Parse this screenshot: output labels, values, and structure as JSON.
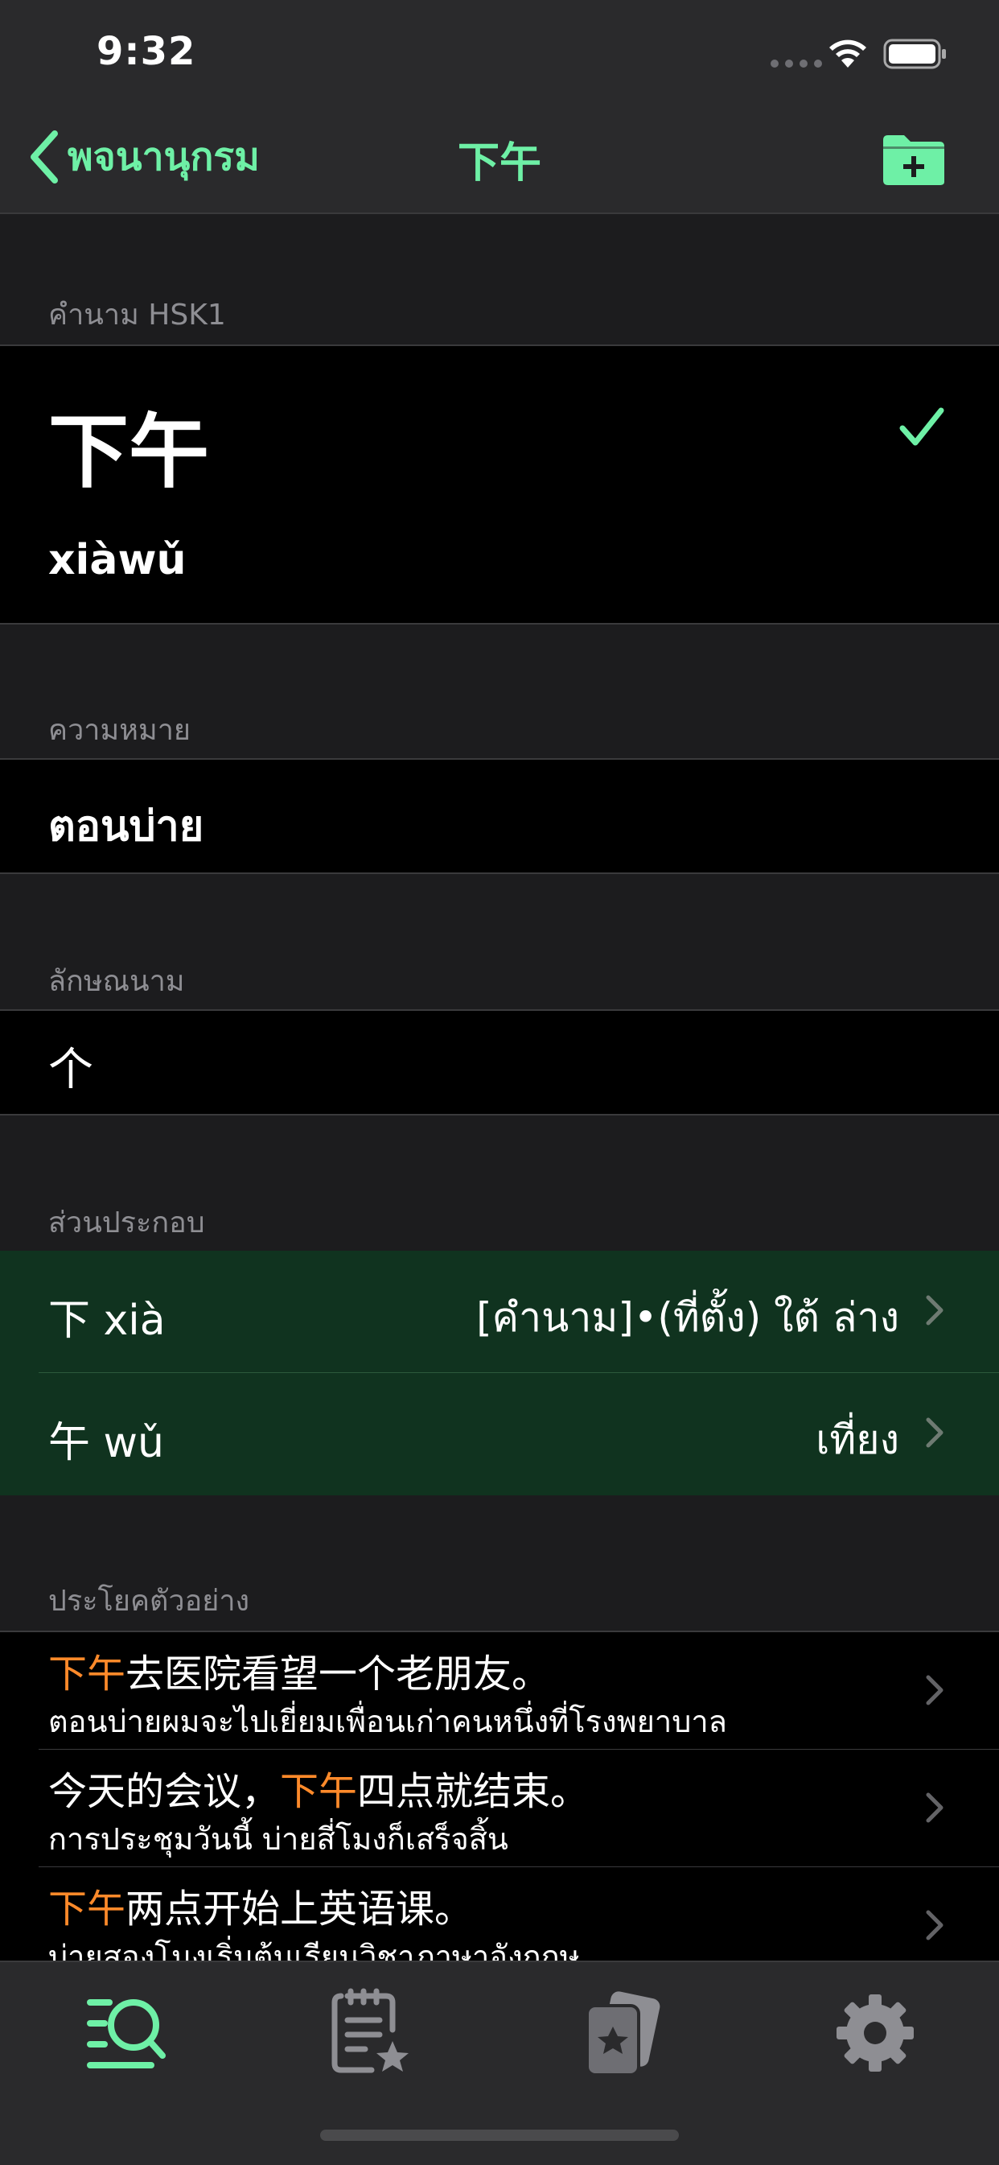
{
  "status": {
    "time": "9:32"
  },
  "nav": {
    "back_label": "พจนานุกรม",
    "title": "下午"
  },
  "word": {
    "section_header": "คำนาม HSK1",
    "hanzi": "下午",
    "pinyin": "xiàwǔ"
  },
  "meaning": {
    "section_header": "ความหมาย",
    "text": "ตอนบ่าย"
  },
  "classifier": {
    "section_header": "ลักษณนาม",
    "text": "个"
  },
  "components": {
    "section_header": "ส่วนประกอบ",
    "items": [
      {
        "char": "下 xià",
        "meaning": "[คำนาม]•(ที่ตั้ง) ใต้ ล่าง"
      },
      {
        "char": "午 wǔ",
        "meaning": "เที่ยง"
      }
    ]
  },
  "examples": {
    "section_header": "ประโยคตัวอย่าง",
    "items": [
      {
        "cn_pre": "",
        "cn_hl": "下午",
        "cn_post": "去医院看望一个老朋友。",
        "th": "ตอนบ่ายผมจะไปเยี่ยมเพื่อนเก่าคนหนึ่งที่โรงพยาบาล"
      },
      {
        "cn_pre": "今天的会议，",
        "cn_hl": "下午",
        "cn_post": "四点就结束。",
        "th": "การประชุมวันนี้ บ่ายสี่โมงก็เสร็จสิ้น"
      },
      {
        "cn_pre": "",
        "cn_hl": "下午",
        "cn_post": "两点开始上英语课。",
        "th": "บ่ายสองโมงเริ่มต้นเรียนวิชาภาษาอังกฤษ"
      }
    ]
  },
  "tabs": [
    {
      "icon": "dictionary-search-icon",
      "active": true
    },
    {
      "icon": "notes-star-icon",
      "active": false
    },
    {
      "icon": "flashcards-star-icon",
      "active": false
    },
    {
      "icon": "gear-icon",
      "active": false
    }
  ],
  "colors": {
    "accent": "#6ef0a6",
    "highlight": "#ff8a2a",
    "component_bg": "#10331f"
  }
}
